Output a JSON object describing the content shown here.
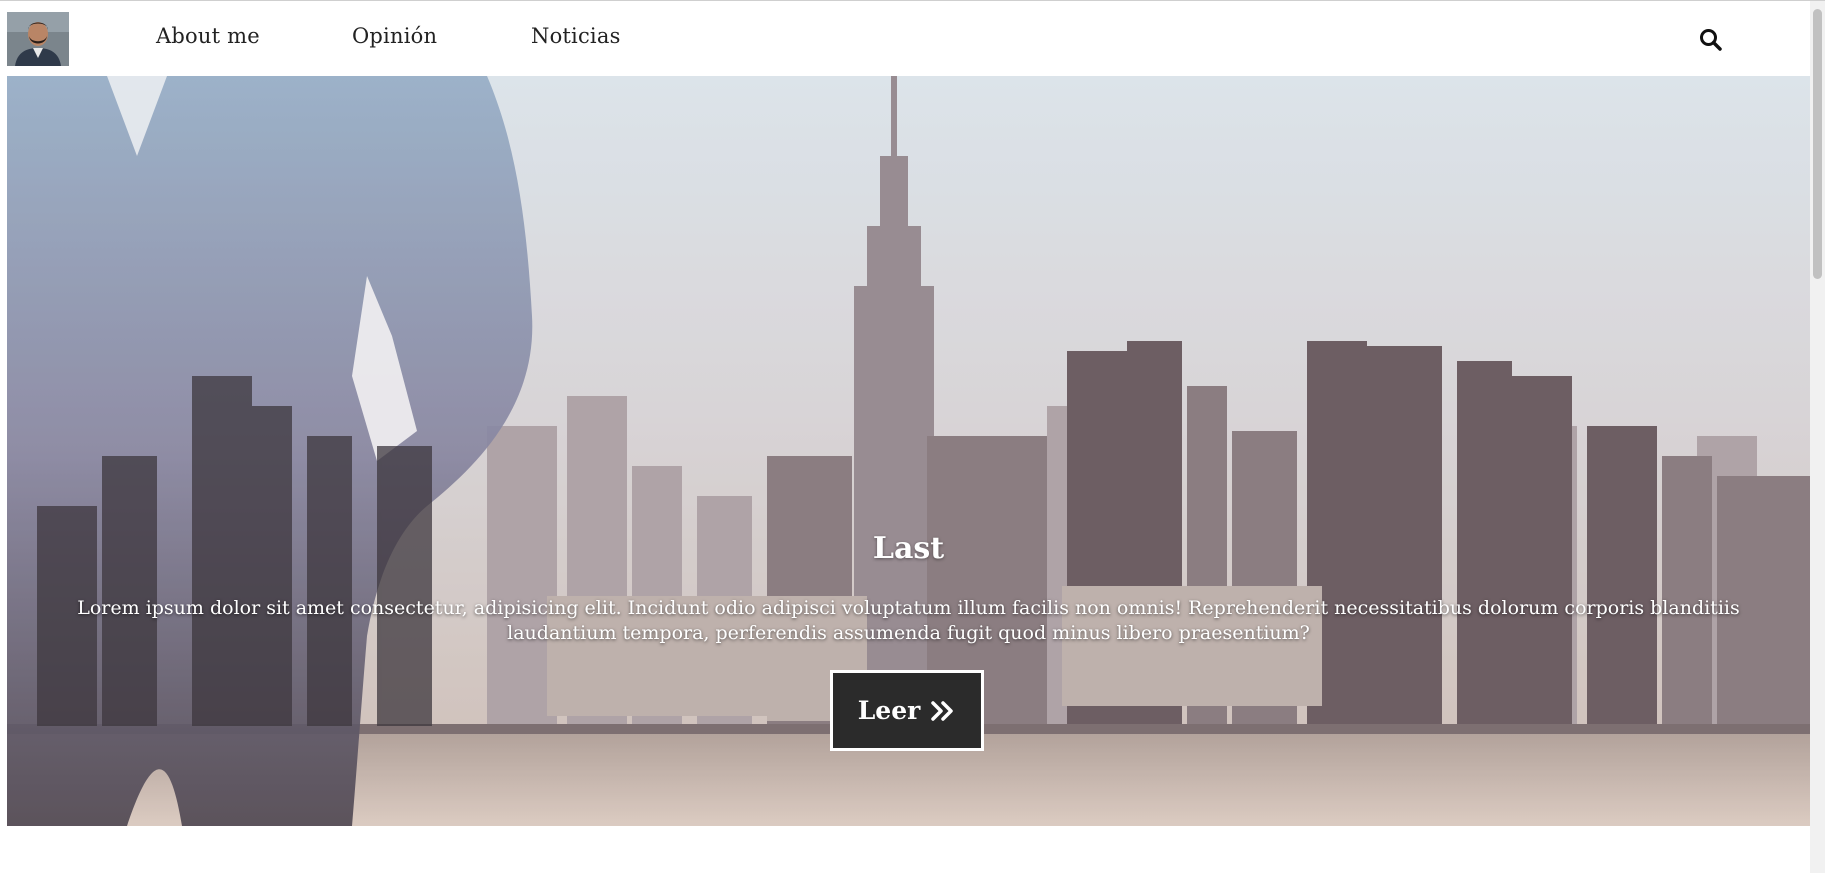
{
  "nav": {
    "items": [
      {
        "label": "About me"
      },
      {
        "label": "Opinión"
      },
      {
        "label": "Noticias"
      }
    ],
    "avatar_icon": "user-photo-icon",
    "search_icon": "search-icon"
  },
  "hero": {
    "title": "Last",
    "text": "Lorem ipsum dolor sit amet consectetur, adipisicing elit. Incidunt odio adipisci voluptatum illum facilis non omnis! Reprehenderit necessitatibus dolorum corporis blanditiis laudantium tempora, perferendis assumenda fugit quod minus libero praesentium?",
    "button_label": "Leer",
    "button_icon": "double-chevron-right-icon"
  },
  "colors": {
    "button_bg": "#2b2b2b",
    "nav_text": "#222222"
  }
}
